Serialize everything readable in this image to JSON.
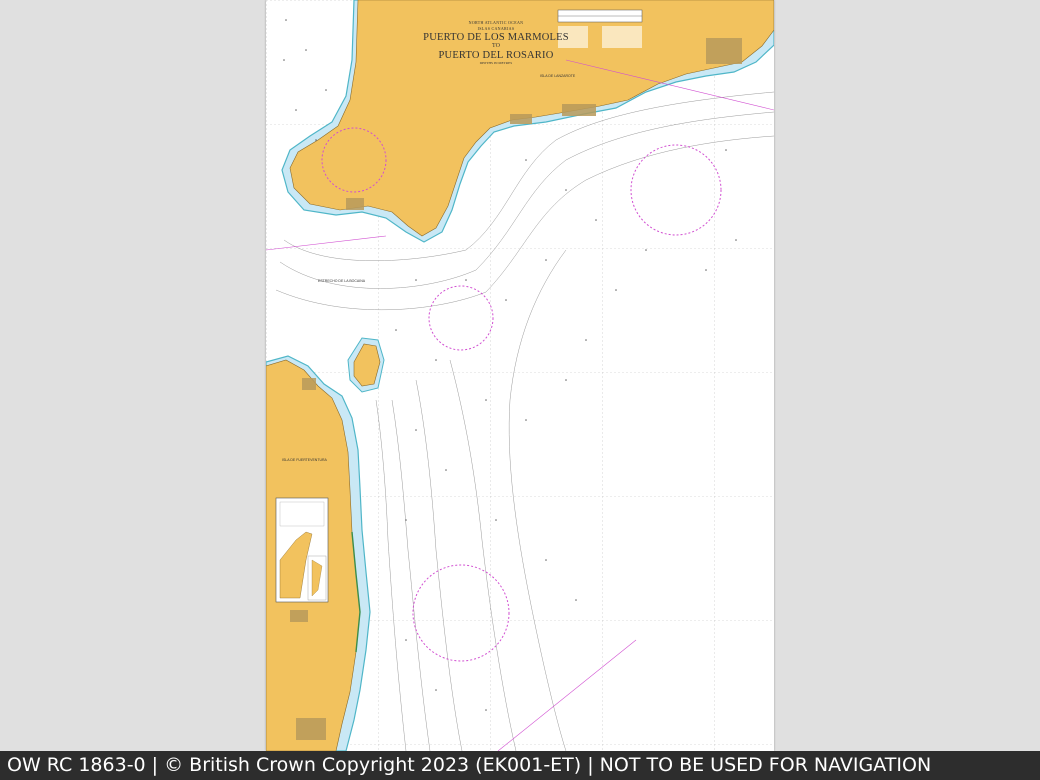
{
  "chart": {
    "ocean": "NORTH ATLANTIC OCEAN",
    "region": "ISLAS CANARIAS",
    "title_line1": "PUERTO DE LOS MARMOLES",
    "title_to": "TO",
    "title_line2": "PUERTO DEL ROSARIO",
    "depths_note": "DEPTHS IN METRES",
    "island_north": "ISLA DE LANZAROTE",
    "island_south": "ISLA DE FUERTEVENTURA",
    "strait": "ESTRECHO DE LA BOCAINA"
  },
  "colors": {
    "land": "#f2c25e",
    "shallow": "#c9e8f5",
    "sea": "#ffffff",
    "magenta": "#d14fd1",
    "background": "#e0e0e0",
    "footer": "#2d2d2d"
  },
  "footer": {
    "text": "OW RC 1863-0 | © British Crown Copyright 2023 (EK001-ET) | NOT TO BE USED FOR NAVIGATION"
  }
}
